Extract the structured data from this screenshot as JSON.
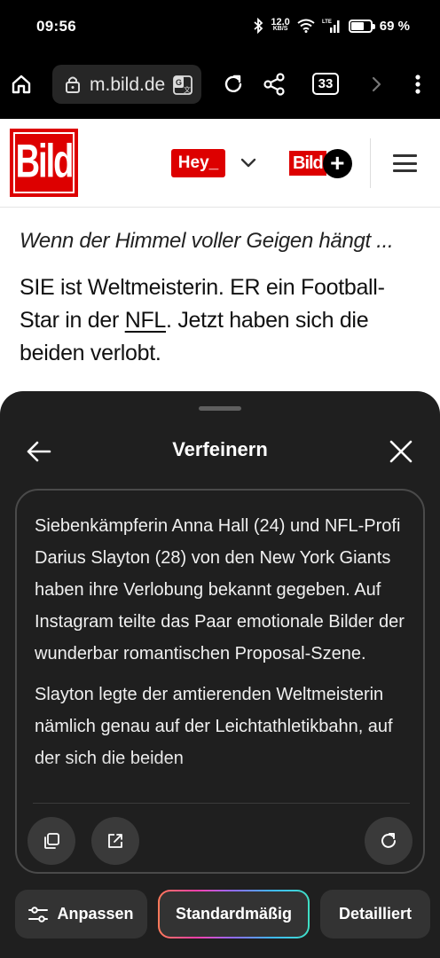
{
  "status_bar": {
    "time": "09:56",
    "net_speed": "12.0",
    "net_unit": "KB/S",
    "network": "LTE",
    "battery": "69 %",
    "battery_level": 0.69
  },
  "browser": {
    "url": "m.bild.de",
    "tab_count": "33"
  },
  "site_header": {
    "logo_text": "Bild",
    "hey_label": "Hey_",
    "bildplus_text": "Bild",
    "bildplus_plus": "+"
  },
  "article": {
    "kicker": "Wenn der Himmel voller Geigen hängt ...",
    "lead_part1": "SIE ist Weltmeisterin. ER ein Football-Star in der ",
    "lead_link": "NFL",
    "lead_part2": ". Jetzt haben sich die beiden verlobt."
  },
  "sheet": {
    "title": "Verfeinern",
    "paragraphs": [
      "Siebenkämpferin Anna Hall (24) und NFL-Profi Darius Slayton (28) von den New York Giants haben ihre Verlobung bekannt gegeben. Auf Instagram teilte das Paar emotionale Bilder der wunderbar romantischen Proposal-Szene.",
      "Slayton legte der amtierenden Weltmeisterin nämlich genau auf der Leichtathletikbahn, auf der sich die beiden"
    ],
    "buttons": {
      "adjust": "Anpassen",
      "standard": "Standardmäßig",
      "detailed": "Detailliert"
    }
  },
  "colors": {
    "bild_red": "#dd0000",
    "sheet_bg": "#1f1f1f",
    "button_bg": "#333333"
  },
  "icons": {
    "home": "home-icon",
    "lock": "lock-icon",
    "translate": "translate-icon",
    "reload": "reload-icon",
    "share": "share-icon",
    "forward": "chevron-right-icon",
    "more": "more-vert-icon",
    "back": "arrow-left-icon",
    "close": "close-icon",
    "copy": "copy-icon",
    "open_external": "open-external-icon",
    "regenerate": "refresh-icon",
    "tune": "tune-icon"
  }
}
